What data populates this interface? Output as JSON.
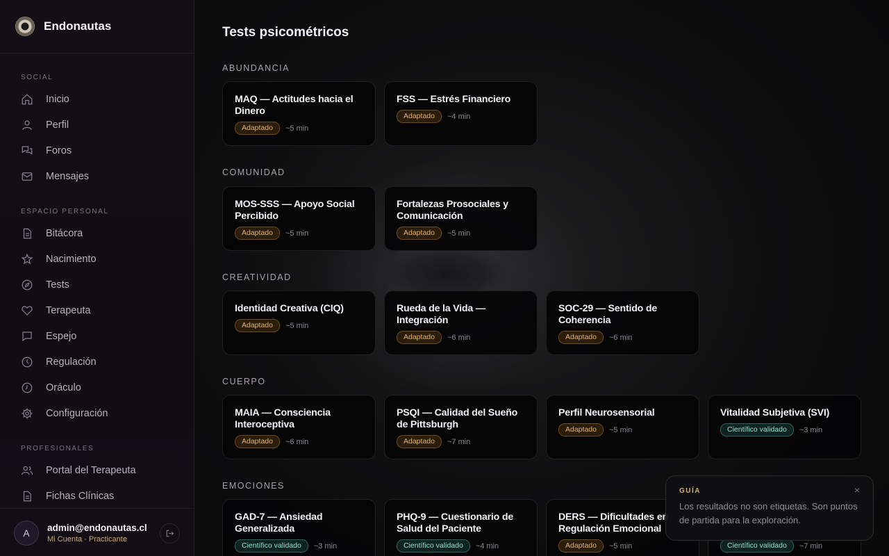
{
  "app": {
    "name": "Endonautas"
  },
  "sidebar": {
    "sections": [
      {
        "title": "SOCIAL",
        "items": [
          {
            "label": "Inicio",
            "icon": "home-icon"
          },
          {
            "label": "Perfil",
            "icon": "user-icon"
          },
          {
            "label": "Foros",
            "icon": "forum-icon"
          },
          {
            "label": "Mensajes",
            "icon": "mail-icon"
          }
        ]
      },
      {
        "title": "ESPACIO PERSONAL",
        "items": [
          {
            "label": "Bitácora",
            "icon": "document-icon"
          },
          {
            "label": "Nacimiento",
            "icon": "star-icon"
          },
          {
            "label": "Tests",
            "icon": "compass-icon"
          },
          {
            "label": "Terapeuta",
            "icon": "heart-icon"
          },
          {
            "label": "Espejo",
            "icon": "chat-icon"
          },
          {
            "label": "Regulación",
            "icon": "clock-icon"
          },
          {
            "label": "Oráculo",
            "icon": "clock-icon"
          },
          {
            "label": "Configuración",
            "icon": "gear-icon"
          }
        ]
      },
      {
        "title": "PROFESIONALES",
        "items": [
          {
            "label": "Portal del Terapeuta",
            "icon": "users-icon"
          },
          {
            "label": "Fichas Clínicas",
            "icon": "document-icon"
          }
        ]
      }
    ]
  },
  "user": {
    "initial": "A",
    "email": "admin@endonautas.cl",
    "subtitle": "Mi Cuenta · Practicante"
  },
  "main": {
    "title": "Tests psicométricos",
    "categories": [
      {
        "name": "ABUNDANCIA",
        "tests": [
          {
            "title": "MAQ — Actitudes hacia el Dinero",
            "badge": "Adaptado",
            "badge_type": "adapt",
            "duration": "~5 min"
          },
          {
            "title": "FSS — Estrés Financiero",
            "badge": "Adaptado",
            "badge_type": "adapt",
            "duration": "~4 min"
          }
        ]
      },
      {
        "name": "COMUNIDAD",
        "tests": [
          {
            "title": "MOS-SSS — Apoyo Social Percibido",
            "badge": "Adaptado",
            "badge_type": "adapt",
            "duration": "~5 min"
          },
          {
            "title": "Fortalezas Prosociales y Comunicación",
            "badge": "Adaptado",
            "badge_type": "adapt",
            "duration": "~5 min"
          }
        ]
      },
      {
        "name": "CREATIVIDAD",
        "tests": [
          {
            "title": "Identidad Creativa (CIQ)",
            "badge": "Adaptado",
            "badge_type": "adapt",
            "duration": "~5 min"
          },
          {
            "title": "Rueda de la Vida — Integración",
            "badge": "Adaptado",
            "badge_type": "adapt",
            "duration": "~6 min"
          },
          {
            "title": "SOC-29 — Sentido de Coherencia",
            "badge": "Adaptado",
            "badge_type": "adapt",
            "duration": "~6 min"
          }
        ]
      },
      {
        "name": "CUERPO",
        "tests": [
          {
            "title": "MAIA — Consciencia Interoceptiva",
            "badge": "Adaptado",
            "badge_type": "adapt",
            "duration": "~6 min"
          },
          {
            "title": "PSQI — Calidad del Sueño de Pittsburgh",
            "badge": "Adaptado",
            "badge_type": "adapt",
            "duration": "~7 min"
          },
          {
            "title": "Perfil Neurosensorial",
            "badge": "Adaptado",
            "badge_type": "adapt",
            "duration": "~5 min"
          },
          {
            "title": "Vitalidad Subjetiva (SVI)",
            "badge": "Científico validado",
            "badge_type": "sci",
            "duration": "~3 min"
          }
        ]
      },
      {
        "name": "EMOCIONES",
        "tests": [
          {
            "title": "GAD-7 — Ansiedad Generalizada",
            "badge": "Científico validado",
            "badge_type": "sci",
            "duration": "~3 min"
          },
          {
            "title": "PHQ-9 — Cuestionario de Salud del Paciente",
            "badge": "Científico validado",
            "badge_type": "sci",
            "duration": "~4 min"
          },
          {
            "title": "DERS — Dificultades en Regulación Emocional",
            "badge": "Adaptado",
            "badge_type": "adapt",
            "duration": "~5 min"
          },
          {
            "title": "",
            "badge": "Científico validado",
            "badge_type": "sci",
            "duration": "~7 min"
          }
        ]
      }
    ]
  },
  "toast": {
    "label": "GUÍA",
    "text": "Los resultados no son etiquetas. Son puntos de partida para la exploración.",
    "close": "×"
  },
  "colors": {
    "accent_gold": "#e3b46b",
    "accent_teal": "#8fe0cf",
    "background": "#0a0a0b"
  }
}
